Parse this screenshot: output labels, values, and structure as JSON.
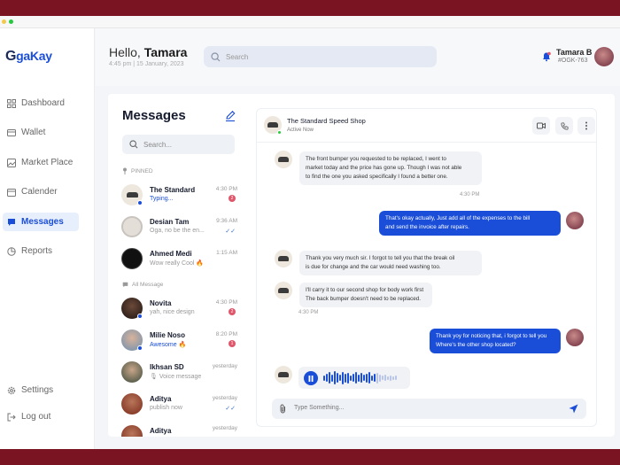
{
  "app": {
    "logo_text": "gaKay",
    "logo_letter": "G"
  },
  "colors": {
    "accent": "#1a4ed8",
    "frame": "#7a1322",
    "badge": "#e0566b"
  },
  "sidebar": {
    "items": [
      {
        "label": "Dashboard",
        "icon": "grid-icon"
      },
      {
        "label": "Wallet",
        "icon": "wallet-icon"
      },
      {
        "label": "Market Place",
        "icon": "image-icon"
      },
      {
        "label": "Calender",
        "icon": "calendar-icon"
      },
      {
        "label": "Messages",
        "icon": "message-icon",
        "active": true
      },
      {
        "label": "Reports",
        "icon": "pie-chart-icon"
      }
    ],
    "bottom": [
      {
        "label": "Settings",
        "icon": "gear-icon"
      },
      {
        "label": "Log out",
        "icon": "logout-icon"
      }
    ]
  },
  "header": {
    "greeting": "Hello, ",
    "name": "Tamara",
    "datetime": "4:45 pm | 15 January, 2023",
    "search_placeholder": "Search",
    "user_name": "Tamara B",
    "user_id": "#OGK-763"
  },
  "messages": {
    "title": "Messages",
    "search_placeholder": "Search...",
    "pinned_label": "PINNED",
    "all_label": "All Message",
    "pinned": [
      {
        "name": "The Standard",
        "preview": "Typing...",
        "time": "4:30 PM",
        "badge": "2",
        "typing": true
      },
      {
        "name": "Desian Tam",
        "preview": "Oga, no be the en...",
        "time": "9:36 AM",
        "tick": "✓✓"
      },
      {
        "name": "Ahmed Medi",
        "preview": "Wow really Cool 🔥",
        "time": "1:15 AM"
      }
    ],
    "all": [
      {
        "name": "Novita",
        "preview": "yah, nice design",
        "time": "4:30 PM",
        "badge": "2"
      },
      {
        "name": "Milie Noso",
        "preview": "Awesome 🔥",
        "time": "8:20 PM",
        "badge": "1"
      },
      {
        "name": "Ikhsan SD",
        "preview": "🎙 Voice message",
        "time": "yesterday"
      },
      {
        "name": "Aditya",
        "preview": "publish now",
        "time": "yesterday",
        "tick": "✓✓"
      },
      {
        "name": "Aditya",
        "preview": "",
        "time": "yesterday"
      }
    ]
  },
  "chat": {
    "contact_name": "The Standard Speed Shop",
    "status": "Active Now",
    "msg1_lines": [
      "The front bumper you requested to be replaced, I went to",
      "market today and the price has gone up. Though I was not able",
      "to find the one you asked specifically I found a better one."
    ],
    "msg1_time": "4:30 PM",
    "msg2_lines": [
      "That's okay actually, Just add all of the expenses to the bill",
      "and send the invoice after repairs."
    ],
    "msg3_lines": [
      "Thank you very much sir. I forgot to tell you that the break oil",
      "is due for change and the car would need washing too."
    ],
    "msg4_lines": [
      "I'll carry it to our second shop for body work first",
      "The back bumper doesn't need to be replaced."
    ],
    "msg4_time": "4:30 PM",
    "msg5_lines": [
      "Thank yoy for noticing that, i forgot to tell you",
      "Where's the other shop located?"
    ],
    "composer_placeholder": "Type Something..."
  }
}
